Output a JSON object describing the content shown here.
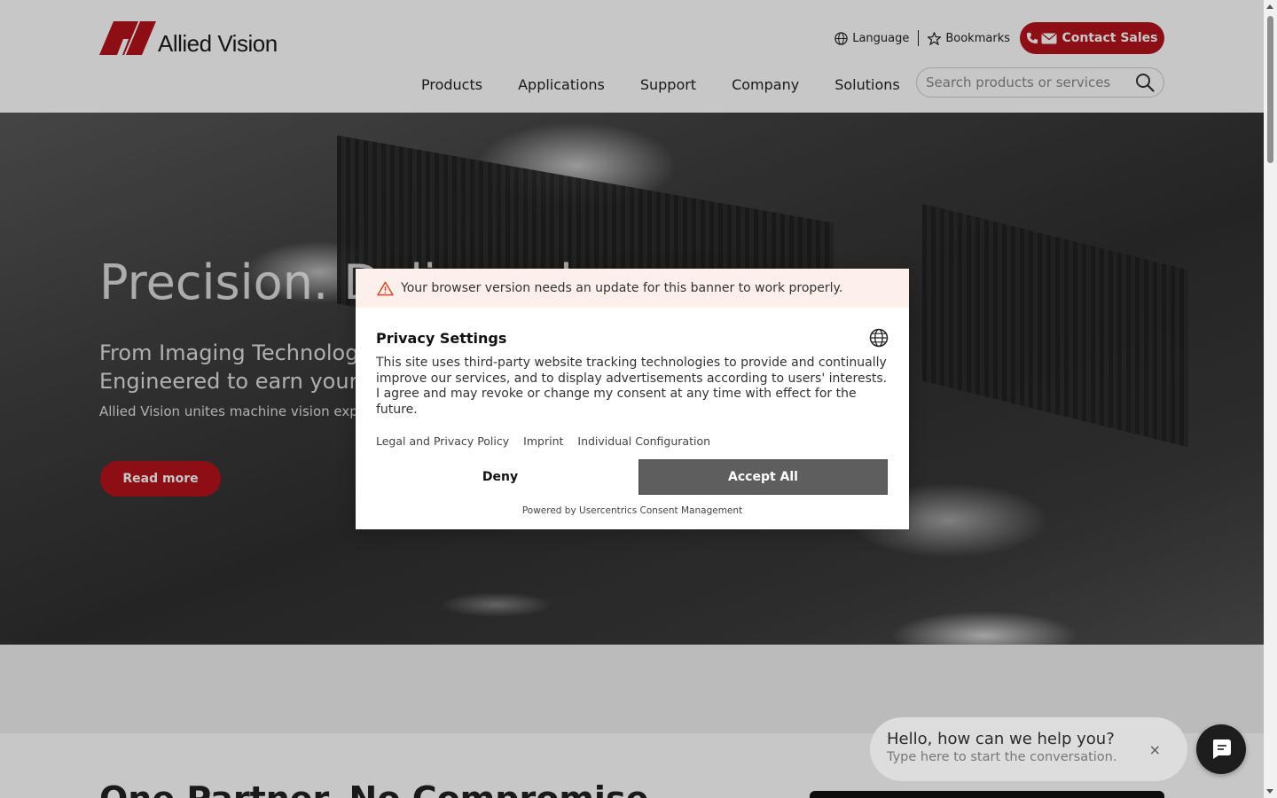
{
  "header": {
    "logo_text": "Allied Vision",
    "language_label": "Language",
    "bookmarks_label": "Bookmarks",
    "contact_label": "Contact Sales",
    "nav": [
      "Products",
      "Applications",
      "Support",
      "Company",
      "Solutions"
    ],
    "search_placeholder": "Search products or services"
  },
  "hero": {
    "title": "Precision. Delivered.",
    "subtitle_line1": "From Imaging Technology to Vision Solutions.",
    "subtitle_line2": "Engineered to earn your Trust.",
    "description": "Allied Vision unites machine vision expertise",
    "read_more": "Read more"
  },
  "consent": {
    "warning": "Your browser version needs an update for this banner to work properly.",
    "title": "Privacy Settings",
    "text": "This site uses third-party website tracking technologies to provide and continually improve our services, and to display advertisements according to users' interests. I agree and may revoke or change my consent at any time with effect for the future.",
    "links": [
      "Legal and Privacy Policy",
      "Imprint",
      "Individual Configuration"
    ],
    "deny": "Deny",
    "accept": "Accept All",
    "powered_by": "Powered by Usercentrics Consent Management"
  },
  "lower": {
    "heading": "One Partner. No Compromise."
  },
  "chat": {
    "title": "Hello, how can we help you?",
    "subtitle": "Type here to start the conversation.",
    "close": "×"
  },
  "colors": {
    "brand_red": "#b5121b",
    "accept_button": "#5e5e5e",
    "warning_bg": "#fdf0ea"
  },
  "icons": [
    "globe-icon",
    "star-icon",
    "phone-icon",
    "mail-icon",
    "search-icon",
    "warning-icon",
    "language-icon",
    "chat-icon",
    "close-icon"
  ]
}
